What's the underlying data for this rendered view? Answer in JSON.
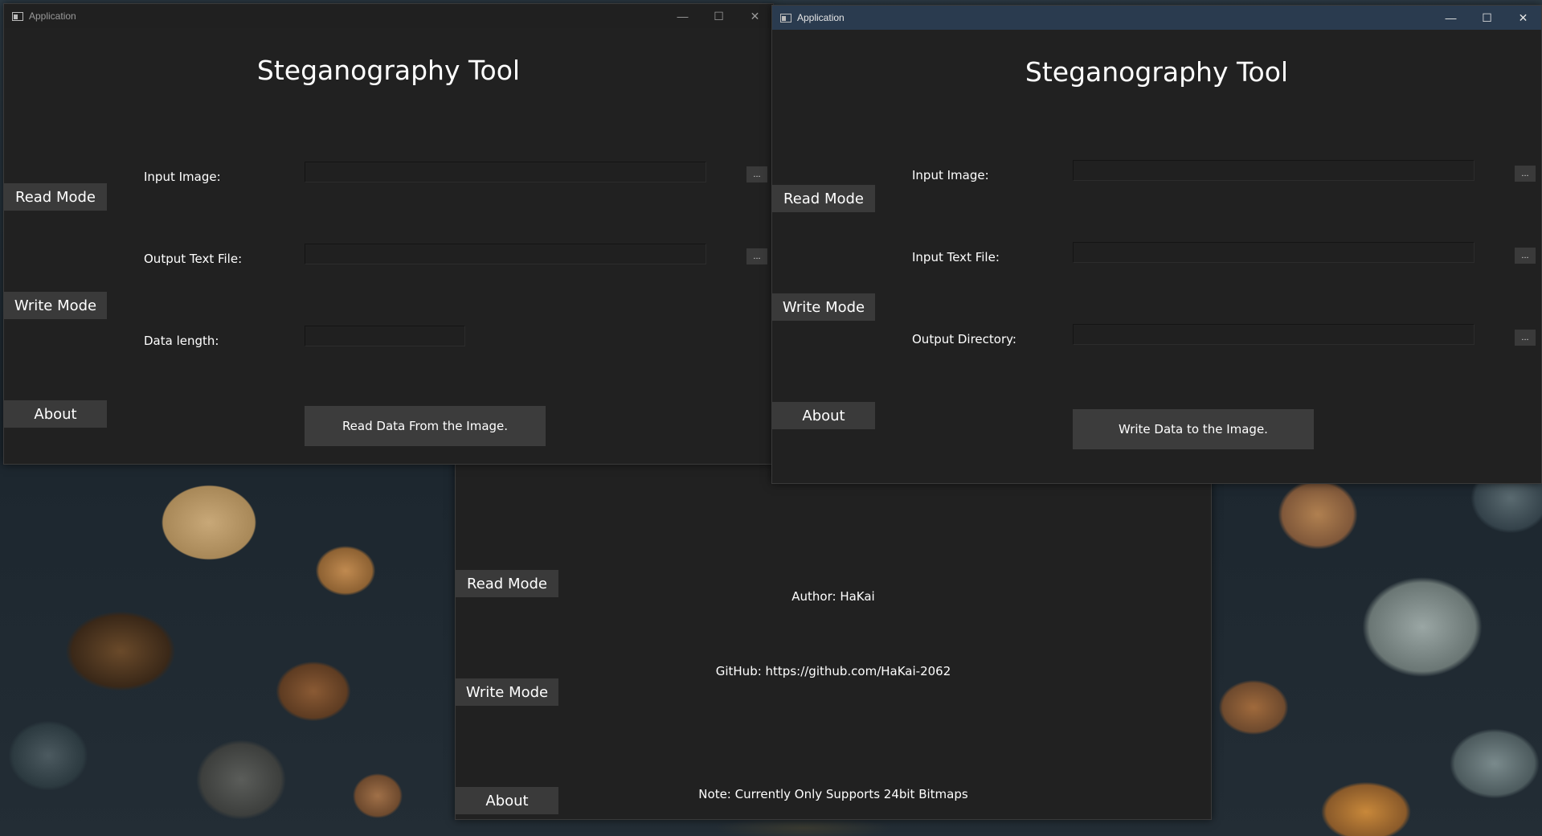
{
  "windows": {
    "left": {
      "title": "Application",
      "heading": "Steganography Tool",
      "nav": {
        "read": "Read Mode",
        "write": "Write Mode",
        "about": "About"
      },
      "fields": [
        {
          "label": "Input Image:",
          "value": "",
          "browse": "..."
        },
        {
          "label": "Output Text File:",
          "value": "",
          "browse": "..."
        },
        {
          "label": "Data length:",
          "value": ""
        }
      ],
      "action": "Read Data From the Image."
    },
    "right": {
      "title": "Application",
      "heading": "Steganography Tool",
      "nav": {
        "read": "Read Mode",
        "write": "Write Mode",
        "about": "About"
      },
      "fields": [
        {
          "label": "Input Image:",
          "value": "",
          "browse": "..."
        },
        {
          "label": "Input Text File:",
          "value": "",
          "browse": "..."
        },
        {
          "label": "Output Directory:",
          "value": "",
          "browse": "..."
        }
      ],
      "action": "Write Data to the Image."
    },
    "back": {
      "nav": {
        "read": "Read Mode",
        "write": "Write Mode",
        "about": "About"
      },
      "author": "Author: HaKai",
      "github": "GitHub: https://github.com/HaKai-2062",
      "note": "Note: Currently Only Supports 24bit Bitmaps"
    }
  },
  "window_controls": {
    "minimize": "—",
    "maximize": "☐",
    "close": "✕"
  }
}
